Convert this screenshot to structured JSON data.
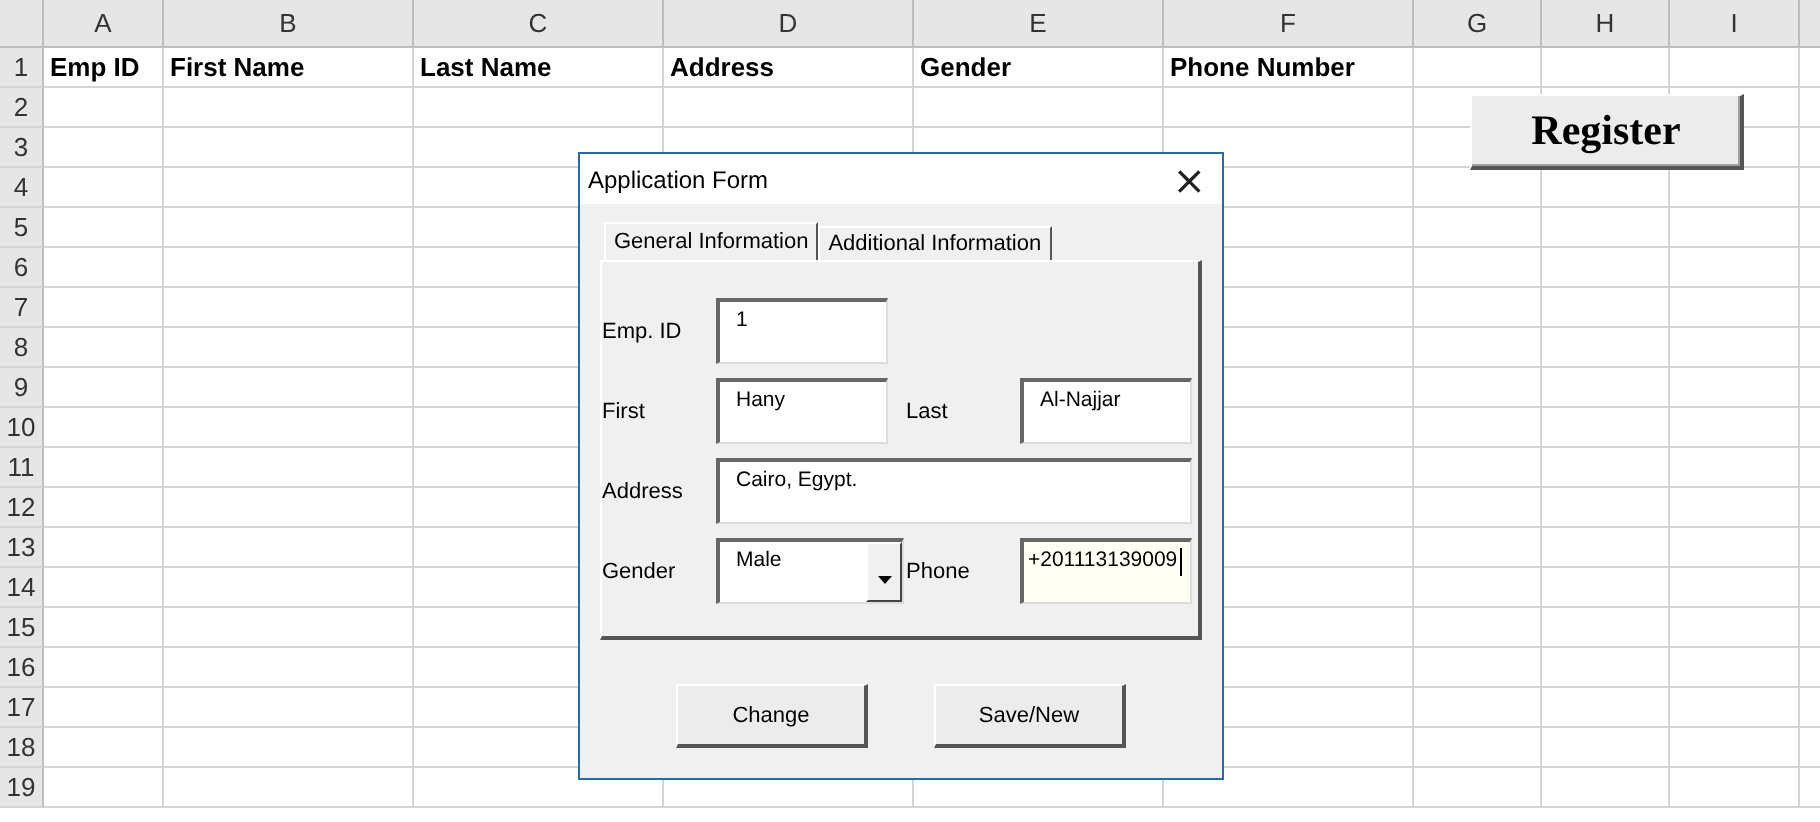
{
  "sheet": {
    "columns": [
      "A",
      "B",
      "C",
      "D",
      "E",
      "F",
      "G",
      "H",
      "I"
    ],
    "row_numbers": [
      "1",
      "2",
      "3",
      "4",
      "5",
      "6",
      "7",
      "8",
      "9",
      "10",
      "11",
      "12",
      "13",
      "14",
      "15",
      "16",
      "17",
      "18",
      "19"
    ],
    "header_cells": [
      "Emp ID",
      "First Name",
      "Last Name",
      "Address",
      "Gender",
      "Phone Number"
    ]
  },
  "register_button": {
    "label": "Register"
  },
  "dialog": {
    "title": "Application Form",
    "close": "×",
    "tabs": [
      {
        "label": "General Information",
        "selected": true
      },
      {
        "label": "Additional Information",
        "selected": false
      }
    ],
    "rows": [
      [
        {
          "label": "Emp. ID",
          "value": "1",
          "kind": "text",
          "focused": false
        }
      ],
      [
        {
          "label": "First",
          "value": "Hany",
          "kind": "text",
          "focused": false
        },
        {
          "label": "Last",
          "value": "Al-Najjar",
          "kind": "text",
          "focused": false
        }
      ],
      [
        {
          "label": "Address",
          "value": "Cairo, Egypt.",
          "kind": "wide",
          "focused": false
        }
      ],
      [
        {
          "label": "Gender",
          "value": "Male",
          "kind": "combo",
          "focused": false
        },
        {
          "label": "Phone",
          "value": "+201113139009",
          "kind": "text",
          "focused": true
        }
      ]
    ],
    "buttons": [
      "Change",
      "Save/New"
    ]
  }
}
